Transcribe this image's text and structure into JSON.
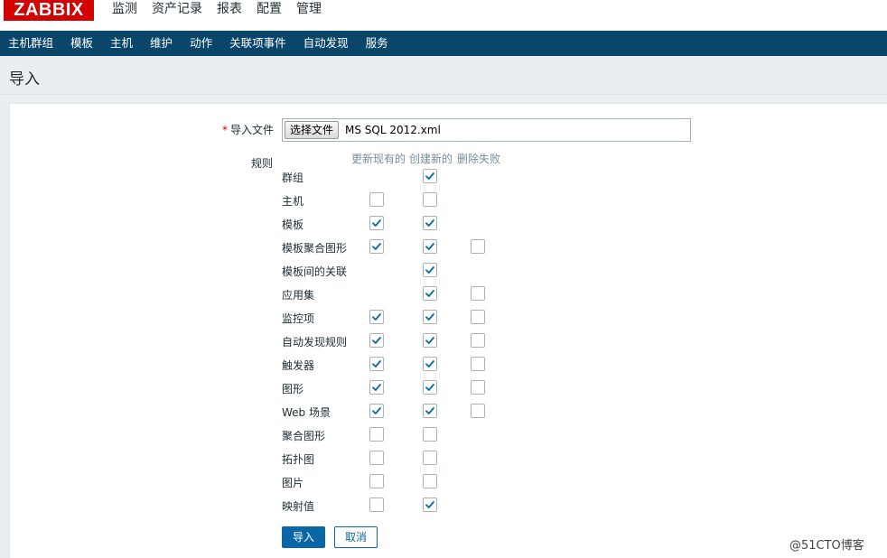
{
  "header": {
    "logo": "ZABBIX",
    "menu": [
      {
        "label": "监测"
      },
      {
        "label": "资产记录"
      },
      {
        "label": "报表"
      },
      {
        "label": "配置",
        "active": true
      },
      {
        "label": "管理"
      }
    ]
  },
  "subnav": [
    {
      "label": "主机群组"
    },
    {
      "label": "模板"
    },
    {
      "label": "主机"
    },
    {
      "label": "维护"
    },
    {
      "label": "动作"
    },
    {
      "label": "关联项事件"
    },
    {
      "label": "自动发现"
    },
    {
      "label": "服务"
    }
  ],
  "page": {
    "title": "导入"
  },
  "form": {
    "required_mark": "*",
    "file_label": "导入文件",
    "file_button": "选择文件",
    "file_name": "MS SQL 2012.xml",
    "rules_label": "规则",
    "columns": [
      "更新现有的",
      "创建新的",
      "删除失败"
    ],
    "rules": [
      {
        "label": "群组",
        "update": null,
        "create": true,
        "delete": null
      },
      {
        "label": "主机",
        "update": false,
        "create": false,
        "delete": null
      },
      {
        "label": "模板",
        "update": true,
        "create": true,
        "delete": null
      },
      {
        "label": "模板聚合图形",
        "update": true,
        "create": true,
        "delete": false
      },
      {
        "label": "模板间的关联",
        "update": null,
        "create": true,
        "delete": null
      },
      {
        "label": "应用集",
        "update": null,
        "create": true,
        "delete": false
      },
      {
        "label": "监控项",
        "update": true,
        "create": true,
        "delete": false
      },
      {
        "label": "自动发现规则",
        "update": true,
        "create": true,
        "delete": false
      },
      {
        "label": "触发器",
        "update": true,
        "create": true,
        "delete": false
      },
      {
        "label": "图形",
        "update": true,
        "create": true,
        "delete": false
      },
      {
        "label": "Web 场景",
        "update": true,
        "create": true,
        "delete": false
      },
      {
        "label": "聚合图形",
        "update": false,
        "create": false,
        "delete": null
      },
      {
        "label": "拓扑图",
        "update": false,
        "create": false,
        "delete": null
      },
      {
        "label": "图片",
        "update": false,
        "create": false,
        "delete": null
      },
      {
        "label": "映射值",
        "update": false,
        "create": true,
        "delete": null
      }
    ],
    "import_button": "导入",
    "cancel_button": "取消"
  },
  "watermark": "@51CTO博客",
  "colors": {
    "brand": "#d40000",
    "nav": "#0a466a",
    "accent": "#0a67a7",
    "check": "#0a67a7"
  },
  "icons": {
    "check": "check-icon"
  }
}
